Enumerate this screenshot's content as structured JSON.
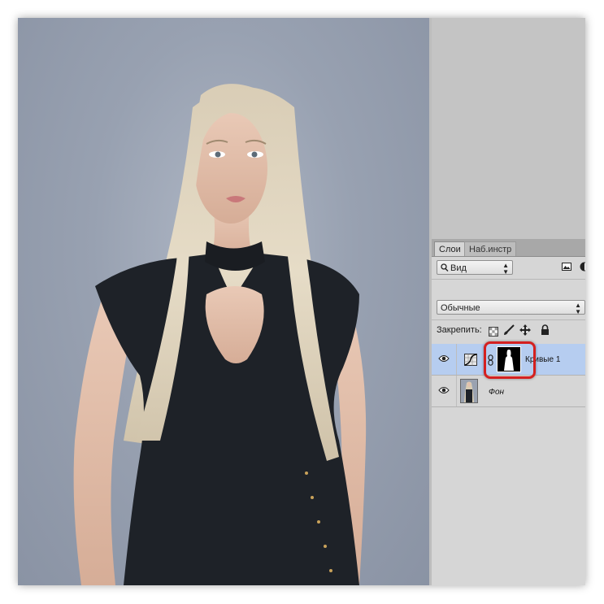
{
  "tabs": {
    "layers": "Слои",
    "adjustments": "Наб.инстр"
  },
  "filter": {
    "kind_label": "Вид"
  },
  "blend_mode": "Обычные",
  "lock_label": "Закрепить:",
  "layers": [
    {
      "name": "Кривые 1",
      "selected": true
    },
    {
      "name": "Фон",
      "selected": false
    }
  ],
  "icons": {
    "filter": "search-icon",
    "image_filter": "image-icon",
    "adjustment_filter": "half-circle-icon",
    "lock_transparent": "checkerboard-icon",
    "lock_pixels": "brush-icon",
    "lock_position": "move-icon",
    "lock_all": "lock-icon",
    "visibility": "eye-icon",
    "curves": "curves-icon",
    "link": "chain-link-icon"
  },
  "colors": {
    "selection": "#b6cdf0",
    "highlight": "#d42020",
    "canvas_bg": "#98a1b1"
  }
}
